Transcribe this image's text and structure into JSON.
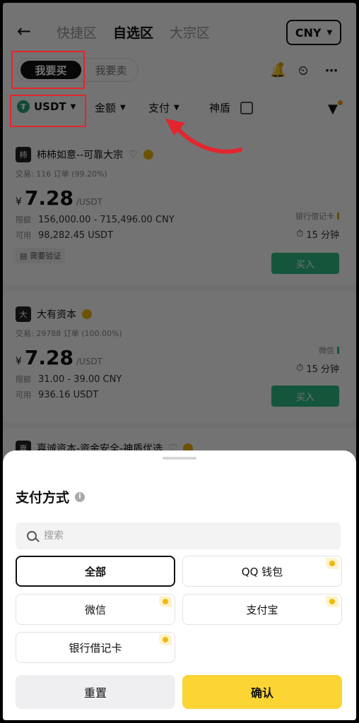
{
  "nav": {
    "back_icon": "arrow-left-icon",
    "tabs": [
      {
        "label": "快捷区",
        "active": false
      },
      {
        "label": "自选区",
        "active": true
      },
      {
        "label": "大宗区",
        "active": false
      }
    ],
    "currency": "CNY"
  },
  "trade_toggle": {
    "buy_label": "我要买",
    "sell_label": "我要卖"
  },
  "filters": {
    "coin": "USDT",
    "amount": "金额",
    "payment": "支付",
    "shield": "神盾"
  },
  "listings": [
    {
      "avatar": "柿",
      "merchant": "柿柿如意--可靠大宗",
      "stats": "交易: 116 订单 (99.20%)",
      "currency_symbol": "¥",
      "price": "7.28",
      "unit": "/USDT",
      "limit_label": "限额",
      "limit": "156,000.00 - 715,496.00 CNY",
      "available_label": "可用",
      "available": "98,282.45 USDT",
      "pay_method": "银行借记卡",
      "time": "15 分钟",
      "buy_label": "买入",
      "verify_label": "需要验证"
    },
    {
      "avatar": "大",
      "merchant": "大有资本",
      "stats": "交易: 29788 订单 (100.00%)",
      "currency_symbol": "¥",
      "price": "7.28",
      "unit": "/USDT",
      "limit_label": "限额",
      "limit": "31.00 - 39.00 CNY",
      "available_label": "可用",
      "available": "936.16 USDT",
      "pay_method": "微信",
      "time": "15 分钟",
      "buy_label": "买入"
    },
    {
      "avatar": "嘉",
      "merchant": "嘉诚资本-资金安全-神盾优选"
    }
  ],
  "sheet": {
    "title": "支付方式",
    "search_placeholder": "搜索",
    "options": [
      "全部",
      "QQ 钱包",
      "微信",
      "支付宝",
      "银行借记卡"
    ],
    "selected": "全部",
    "reset": "重置",
    "confirm": "确认"
  },
  "colors": {
    "accent": "#fcd535",
    "buy": "#2ebd85",
    "annotation": "#e3262d"
  }
}
